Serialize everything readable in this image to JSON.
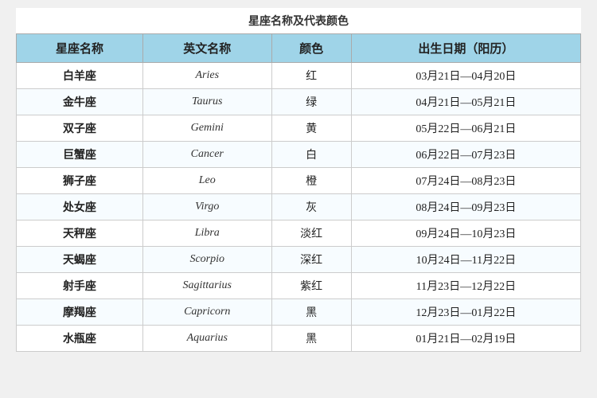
{
  "page": {
    "title": "星座名称及代表颜色",
    "headers": [
      "星座名称",
      "英文名称",
      "颜色",
      "出生日期（阳历）"
    ],
    "rows": [
      {
        "chinese": "白羊座",
        "english": "Aries",
        "color": "红",
        "dates": "03月21日—04月20日"
      },
      {
        "chinese": "金牛座",
        "english": "Taurus",
        "color": "绿",
        "dates": "04月21日—05月21日"
      },
      {
        "chinese": "双子座",
        "english": "Gemini",
        "color": "黄",
        "dates": "05月22日—06月21日"
      },
      {
        "chinese": "巨蟹座",
        "english": "Cancer",
        "color": "白",
        "dates": "06月22日—07月23日"
      },
      {
        "chinese": "狮子座",
        "english": "Leo",
        "color": "橙",
        "dates": "07月24日—08月23日"
      },
      {
        "chinese": "处女座",
        "english": "Virgo",
        "color": "灰",
        "dates": "08月24日—09月23日"
      },
      {
        "chinese": "天秤座",
        "english": "Libra",
        "color": "淡红",
        "dates": "09月24日—10月23日"
      },
      {
        "chinese": "天蝎座",
        "english": "Scorpio",
        "color": "深红",
        "dates": "10月24日—11月22日"
      },
      {
        "chinese": "射手座",
        "english": "Sagittarius",
        "color": "紫红",
        "dates": "11月23日—12月22日"
      },
      {
        "chinese": "摩羯座",
        "english": "Capricorn",
        "color": "黑",
        "dates": "12月23日—01月22日"
      },
      {
        "chinese": "水瓶座",
        "english": "Aquarius",
        "color": "黑",
        "dates": "01月21日—02月19日"
      }
    ]
  }
}
